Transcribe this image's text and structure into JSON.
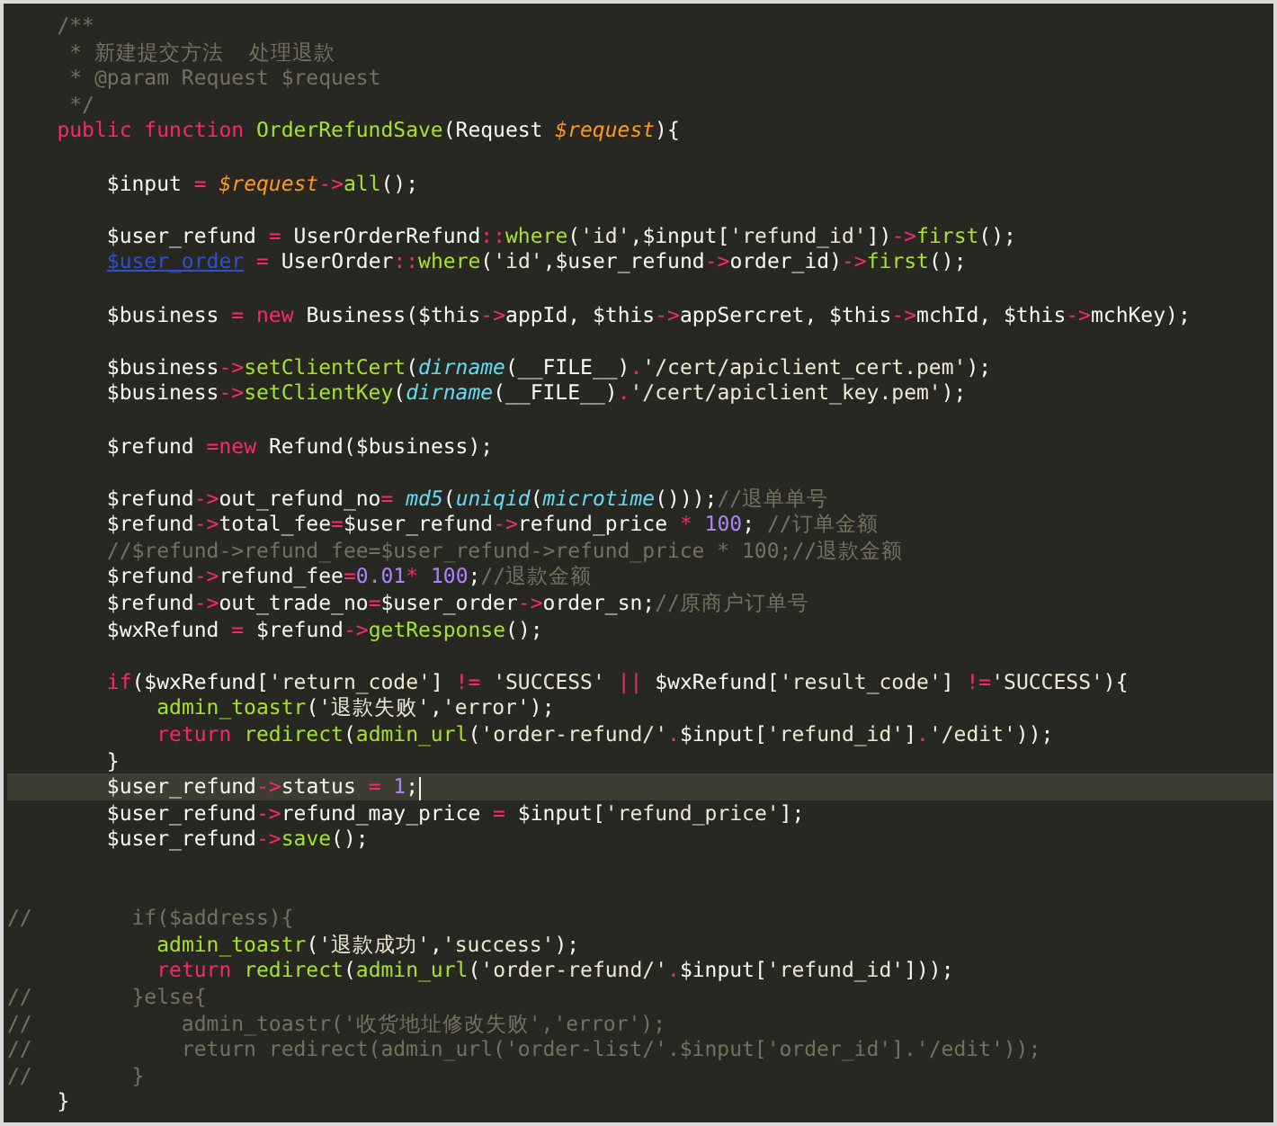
{
  "editor": {
    "lines": [
      {
        "current": false,
        "tokens": [
          {
            "kind": "comment",
            "text": "    /**"
          }
        ]
      },
      {
        "current": false,
        "tokens": [
          {
            "kind": "comment",
            "text": "     * 新建提交方法  处理退款"
          }
        ]
      },
      {
        "current": false,
        "tokens": [
          {
            "kind": "comment",
            "text": "     * @param Request $request"
          }
        ]
      },
      {
        "current": false,
        "tokens": [
          {
            "kind": "comment",
            "text": "     */"
          }
        ]
      },
      {
        "current": false,
        "tokens": [
          {
            "kind": "keyword",
            "text": "    public "
          },
          {
            "kind": "keyword",
            "text": "function "
          },
          {
            "kind": "function",
            "text": "OrderRefundSave"
          },
          {
            "kind": "plain",
            "text": "(Request "
          },
          {
            "kind": "param",
            "text": "$request"
          },
          {
            "kind": "plain",
            "text": "){"
          }
        ]
      },
      {
        "current": false
      },
      {
        "current": false,
        "tokens": [
          {
            "kind": "plain",
            "text": "        $input "
          },
          {
            "kind": "operator",
            "text": "= "
          },
          {
            "kind": "param",
            "text": "$request"
          },
          {
            "kind": "operator",
            "text": "->"
          },
          {
            "kind": "function",
            "text": "all"
          },
          {
            "kind": "plain",
            "text": "();"
          }
        ]
      },
      {
        "current": false
      },
      {
        "current": false,
        "tokens": [
          {
            "kind": "plain",
            "text": "        $user_refund "
          },
          {
            "kind": "operator",
            "text": "="
          },
          {
            "kind": "plain",
            "text": " UserOrderRefund"
          },
          {
            "kind": "operator",
            "text": "::"
          },
          {
            "kind": "function",
            "text": "where"
          },
          {
            "kind": "plain",
            "text": "("
          },
          {
            "kind": "string",
            "text": "'id'"
          },
          {
            "kind": "plain",
            "text": ",$input["
          },
          {
            "kind": "string",
            "text": "'refund_id'"
          },
          {
            "kind": "plain",
            "text": "])"
          },
          {
            "kind": "operator",
            "text": "->"
          },
          {
            "kind": "function",
            "text": "first"
          },
          {
            "kind": "plain",
            "text": "();"
          }
        ]
      },
      {
        "current": false,
        "tokens": [
          {
            "kind": "link",
            "text": "        $user_order"
          },
          {
            "kind": "operator",
            "text": " ="
          },
          {
            "kind": "plain",
            "text": " UserOrder"
          },
          {
            "kind": "operator",
            "text": "::"
          },
          {
            "kind": "function",
            "text": "where"
          },
          {
            "kind": "plain",
            "text": "("
          },
          {
            "kind": "string",
            "text": "'id'"
          },
          {
            "kind": "plain",
            "text": ",$user_refund"
          },
          {
            "kind": "operator",
            "text": "->"
          },
          {
            "kind": "plain",
            "text": "order_id)"
          },
          {
            "kind": "operator",
            "text": "->"
          },
          {
            "kind": "function",
            "text": "first"
          },
          {
            "kind": "plain",
            "text": "();"
          }
        ]
      },
      {
        "current": false
      },
      {
        "current": false,
        "tokens": [
          {
            "kind": "plain",
            "text": "        $business "
          },
          {
            "kind": "operator",
            "text": "= "
          },
          {
            "kind": "keyword",
            "text": "new"
          },
          {
            "kind": "plain",
            "text": " Business($this"
          },
          {
            "kind": "operator",
            "text": "->"
          },
          {
            "kind": "plain",
            "text": "appId, $this"
          },
          {
            "kind": "operator",
            "text": "->"
          },
          {
            "kind": "plain",
            "text": "appSercret, $this"
          },
          {
            "kind": "operator",
            "text": "->"
          },
          {
            "kind": "plain",
            "text": "mchId, $this"
          },
          {
            "kind": "operator",
            "text": "->"
          },
          {
            "kind": "plain",
            "text": "mchKey);"
          }
        ]
      },
      {
        "current": false
      },
      {
        "current": false,
        "tokens": [
          {
            "kind": "plain",
            "text": "        $business"
          },
          {
            "kind": "operator",
            "text": "->"
          },
          {
            "kind": "function",
            "text": "setClientCert"
          },
          {
            "kind": "plain",
            "text": "("
          },
          {
            "kind": "builtin",
            "text": "dirname"
          },
          {
            "kind": "plain",
            "text": "(__FILE__)"
          },
          {
            "kind": "operator",
            "text": "."
          },
          {
            "kind": "string",
            "text": "'/cert/apiclient_cert.pem'"
          },
          {
            "kind": "plain",
            "text": ");"
          }
        ]
      },
      {
        "current": false,
        "tokens": [
          {
            "kind": "plain",
            "text": "        $business"
          },
          {
            "kind": "operator",
            "text": "->"
          },
          {
            "kind": "function",
            "text": "setClientKey"
          },
          {
            "kind": "plain",
            "text": "("
          },
          {
            "kind": "builtin",
            "text": "dirname"
          },
          {
            "kind": "plain",
            "text": "(__FILE__)"
          },
          {
            "kind": "operator",
            "text": "."
          },
          {
            "kind": "string",
            "text": "'/cert/apiclient_key.pem'"
          },
          {
            "kind": "plain",
            "text": ");"
          }
        ]
      },
      {
        "current": false
      },
      {
        "current": false,
        "tokens": [
          {
            "kind": "plain",
            "text": "        $refund "
          },
          {
            "kind": "operator",
            "text": "="
          },
          {
            "kind": "keyword",
            "text": "new"
          },
          {
            "kind": "plain",
            "text": " Refund($business);"
          }
        ]
      },
      {
        "current": false
      },
      {
        "current": false,
        "tokens": [
          {
            "kind": "plain",
            "text": "        $refund"
          },
          {
            "kind": "operator",
            "text": "->"
          },
          {
            "kind": "plain",
            "text": "out_refund_no"
          },
          {
            "kind": "operator",
            "text": "= "
          },
          {
            "kind": "builtin",
            "text": "md5"
          },
          {
            "kind": "plain",
            "text": "("
          },
          {
            "kind": "builtin",
            "text": "uniqid"
          },
          {
            "kind": "plain",
            "text": "("
          },
          {
            "kind": "builtin",
            "text": "microtime"
          },
          {
            "kind": "plain",
            "text": "()));"
          },
          {
            "kind": "comment",
            "text": "//退单单号"
          }
        ]
      },
      {
        "current": false,
        "tokens": [
          {
            "kind": "plain",
            "text": "        $refund"
          },
          {
            "kind": "operator",
            "text": "->"
          },
          {
            "kind": "plain",
            "text": "total_fee"
          },
          {
            "kind": "operator",
            "text": "="
          },
          {
            "kind": "plain",
            "text": "$user_refund"
          },
          {
            "kind": "operator",
            "text": "->"
          },
          {
            "kind": "plain",
            "text": "refund_price "
          },
          {
            "kind": "operator",
            "text": "* "
          },
          {
            "kind": "number",
            "text": "100"
          },
          {
            "kind": "plain",
            "text": "; "
          },
          {
            "kind": "comment",
            "text": "//订单金额"
          }
        ]
      },
      {
        "current": false,
        "tokens": [
          {
            "kind": "comment",
            "text": "        //$refund->refund_fee=$user_refund->refund_price * 100;//退款金额"
          }
        ]
      },
      {
        "current": false,
        "tokens": [
          {
            "kind": "plain",
            "text": "        $refund"
          },
          {
            "kind": "operator",
            "text": "->"
          },
          {
            "kind": "plain",
            "text": "refund_fee"
          },
          {
            "kind": "operator",
            "text": "="
          },
          {
            "kind": "number",
            "text": "0.01"
          },
          {
            "kind": "operator",
            "text": "* "
          },
          {
            "kind": "number",
            "text": "100"
          },
          {
            "kind": "plain",
            "text": ";"
          },
          {
            "kind": "comment",
            "text": "//退款金额"
          }
        ]
      },
      {
        "current": false,
        "tokens": [
          {
            "kind": "plain",
            "text": "        $refund"
          },
          {
            "kind": "operator",
            "text": "->"
          },
          {
            "kind": "plain",
            "text": "out_trade_no"
          },
          {
            "kind": "operator",
            "text": "="
          },
          {
            "kind": "plain",
            "text": "$user_order"
          },
          {
            "kind": "operator",
            "text": "->"
          },
          {
            "kind": "plain",
            "text": "order_sn;"
          },
          {
            "kind": "comment",
            "text": "//原商户订单号"
          }
        ]
      },
      {
        "current": false,
        "tokens": [
          {
            "kind": "plain",
            "text": "        $wxRefund "
          },
          {
            "kind": "operator",
            "text": "="
          },
          {
            "kind": "plain",
            "text": " $refund"
          },
          {
            "kind": "operator",
            "text": "->"
          },
          {
            "kind": "function",
            "text": "getResponse"
          },
          {
            "kind": "plain",
            "text": "();"
          }
        ]
      },
      {
        "current": false
      },
      {
        "current": false,
        "tokens": [
          {
            "kind": "keyword",
            "text": "        if"
          },
          {
            "kind": "plain",
            "text": "($wxRefund["
          },
          {
            "kind": "string",
            "text": "'return_code'"
          },
          {
            "kind": "plain",
            "text": "] "
          },
          {
            "kind": "operator",
            "text": "!= "
          },
          {
            "kind": "string",
            "text": "'SUCCESS'"
          },
          {
            "kind": "operator",
            "text": " ||"
          },
          {
            "kind": "plain",
            "text": " $wxRefund["
          },
          {
            "kind": "string",
            "text": "'result_code'"
          },
          {
            "kind": "plain",
            "text": "] "
          },
          {
            "kind": "operator",
            "text": "!="
          },
          {
            "kind": "string",
            "text": "'SUCCESS'"
          },
          {
            "kind": "plain",
            "text": "){"
          }
        ]
      },
      {
        "current": false,
        "tokens": [
          {
            "kind": "function",
            "text": "            admin_toastr"
          },
          {
            "kind": "plain",
            "text": "("
          },
          {
            "kind": "string",
            "text": "'退款失败'"
          },
          {
            "kind": "plain",
            "text": ","
          },
          {
            "kind": "string",
            "text": "'error'"
          },
          {
            "kind": "plain",
            "text": ");"
          }
        ]
      },
      {
        "current": false,
        "tokens": [
          {
            "kind": "keyword",
            "text": "            return "
          },
          {
            "kind": "function",
            "text": "redirect"
          },
          {
            "kind": "plain",
            "text": "("
          },
          {
            "kind": "function",
            "text": "admin_url"
          },
          {
            "kind": "plain",
            "text": "("
          },
          {
            "kind": "string",
            "text": "'order-refund/'"
          },
          {
            "kind": "operator",
            "text": "."
          },
          {
            "kind": "plain",
            "text": "$input["
          },
          {
            "kind": "string",
            "text": "'refund_id'"
          },
          {
            "kind": "plain",
            "text": "]"
          },
          {
            "kind": "operator",
            "text": "."
          },
          {
            "kind": "string",
            "text": "'/edit'"
          },
          {
            "kind": "plain",
            "text": "));"
          }
        ]
      },
      {
        "current": false,
        "tokens": [
          {
            "kind": "plain",
            "text": "        }"
          }
        ]
      },
      {
        "current": true,
        "tokens": [
          {
            "kind": "plain",
            "text": "        $user_refund"
          },
          {
            "kind": "operator",
            "text": "->"
          },
          {
            "kind": "plain",
            "text": "status "
          },
          {
            "kind": "operator",
            "text": "= "
          },
          {
            "kind": "number",
            "text": "1"
          },
          {
            "kind": "plain",
            "text": ";"
          }
        ]
      },
      {
        "current": false,
        "tokens": [
          {
            "kind": "plain",
            "text": "        $user_refund"
          },
          {
            "kind": "operator",
            "text": "->"
          },
          {
            "kind": "plain",
            "text": "refund_may_price "
          },
          {
            "kind": "operator",
            "text": "="
          },
          {
            "kind": "plain",
            "text": " $input["
          },
          {
            "kind": "string",
            "text": "'refund_price'"
          },
          {
            "kind": "plain",
            "text": "];"
          }
        ]
      },
      {
        "current": false,
        "tokens": [
          {
            "kind": "plain",
            "text": "        $user_refund"
          },
          {
            "kind": "operator",
            "text": "->"
          },
          {
            "kind": "function",
            "text": "save"
          },
          {
            "kind": "plain",
            "text": "();"
          }
        ]
      },
      {
        "current": false
      },
      {
        "current": false
      },
      {
        "current": false,
        "tokens": [
          {
            "kind": "comment",
            "text": "//        if($address){"
          }
        ]
      },
      {
        "current": false,
        "tokens": [
          {
            "kind": "function",
            "text": "            admin_toastr"
          },
          {
            "kind": "plain",
            "text": "("
          },
          {
            "kind": "string",
            "text": "'退款成功'"
          },
          {
            "kind": "plain",
            "text": ","
          },
          {
            "kind": "string",
            "text": "'success'"
          },
          {
            "kind": "plain",
            "text": ");"
          }
        ]
      },
      {
        "current": false,
        "tokens": [
          {
            "kind": "keyword",
            "text": "            return "
          },
          {
            "kind": "function",
            "text": "redirect"
          },
          {
            "kind": "plain",
            "text": "("
          },
          {
            "kind": "function",
            "text": "admin_url"
          },
          {
            "kind": "plain",
            "text": "("
          },
          {
            "kind": "string",
            "text": "'order-refund/'"
          },
          {
            "kind": "operator",
            "text": "."
          },
          {
            "kind": "plain",
            "text": "$input["
          },
          {
            "kind": "string",
            "text": "'refund_id'"
          },
          {
            "kind": "plain",
            "text": "]));"
          }
        ]
      },
      {
        "current": false,
        "tokens": [
          {
            "kind": "comment",
            "text": "//        }else{"
          }
        ]
      },
      {
        "current": false,
        "tokens": [
          {
            "kind": "comment",
            "text": "//            admin_toastr('收货地址修改失败','error');"
          }
        ]
      },
      {
        "current": false,
        "tokens": [
          {
            "kind": "comment",
            "text": "//            return redirect(admin_url('order-list/'.$input['order_id'].'/edit'));"
          }
        ]
      },
      {
        "current": false,
        "tokens": [
          {
            "kind": "comment",
            "text": "//        }"
          }
        ]
      },
      {
        "current": false,
        "tokens": [
          {
            "kind": "plain",
            "text": "    }"
          }
        ]
      }
    ]
  }
}
